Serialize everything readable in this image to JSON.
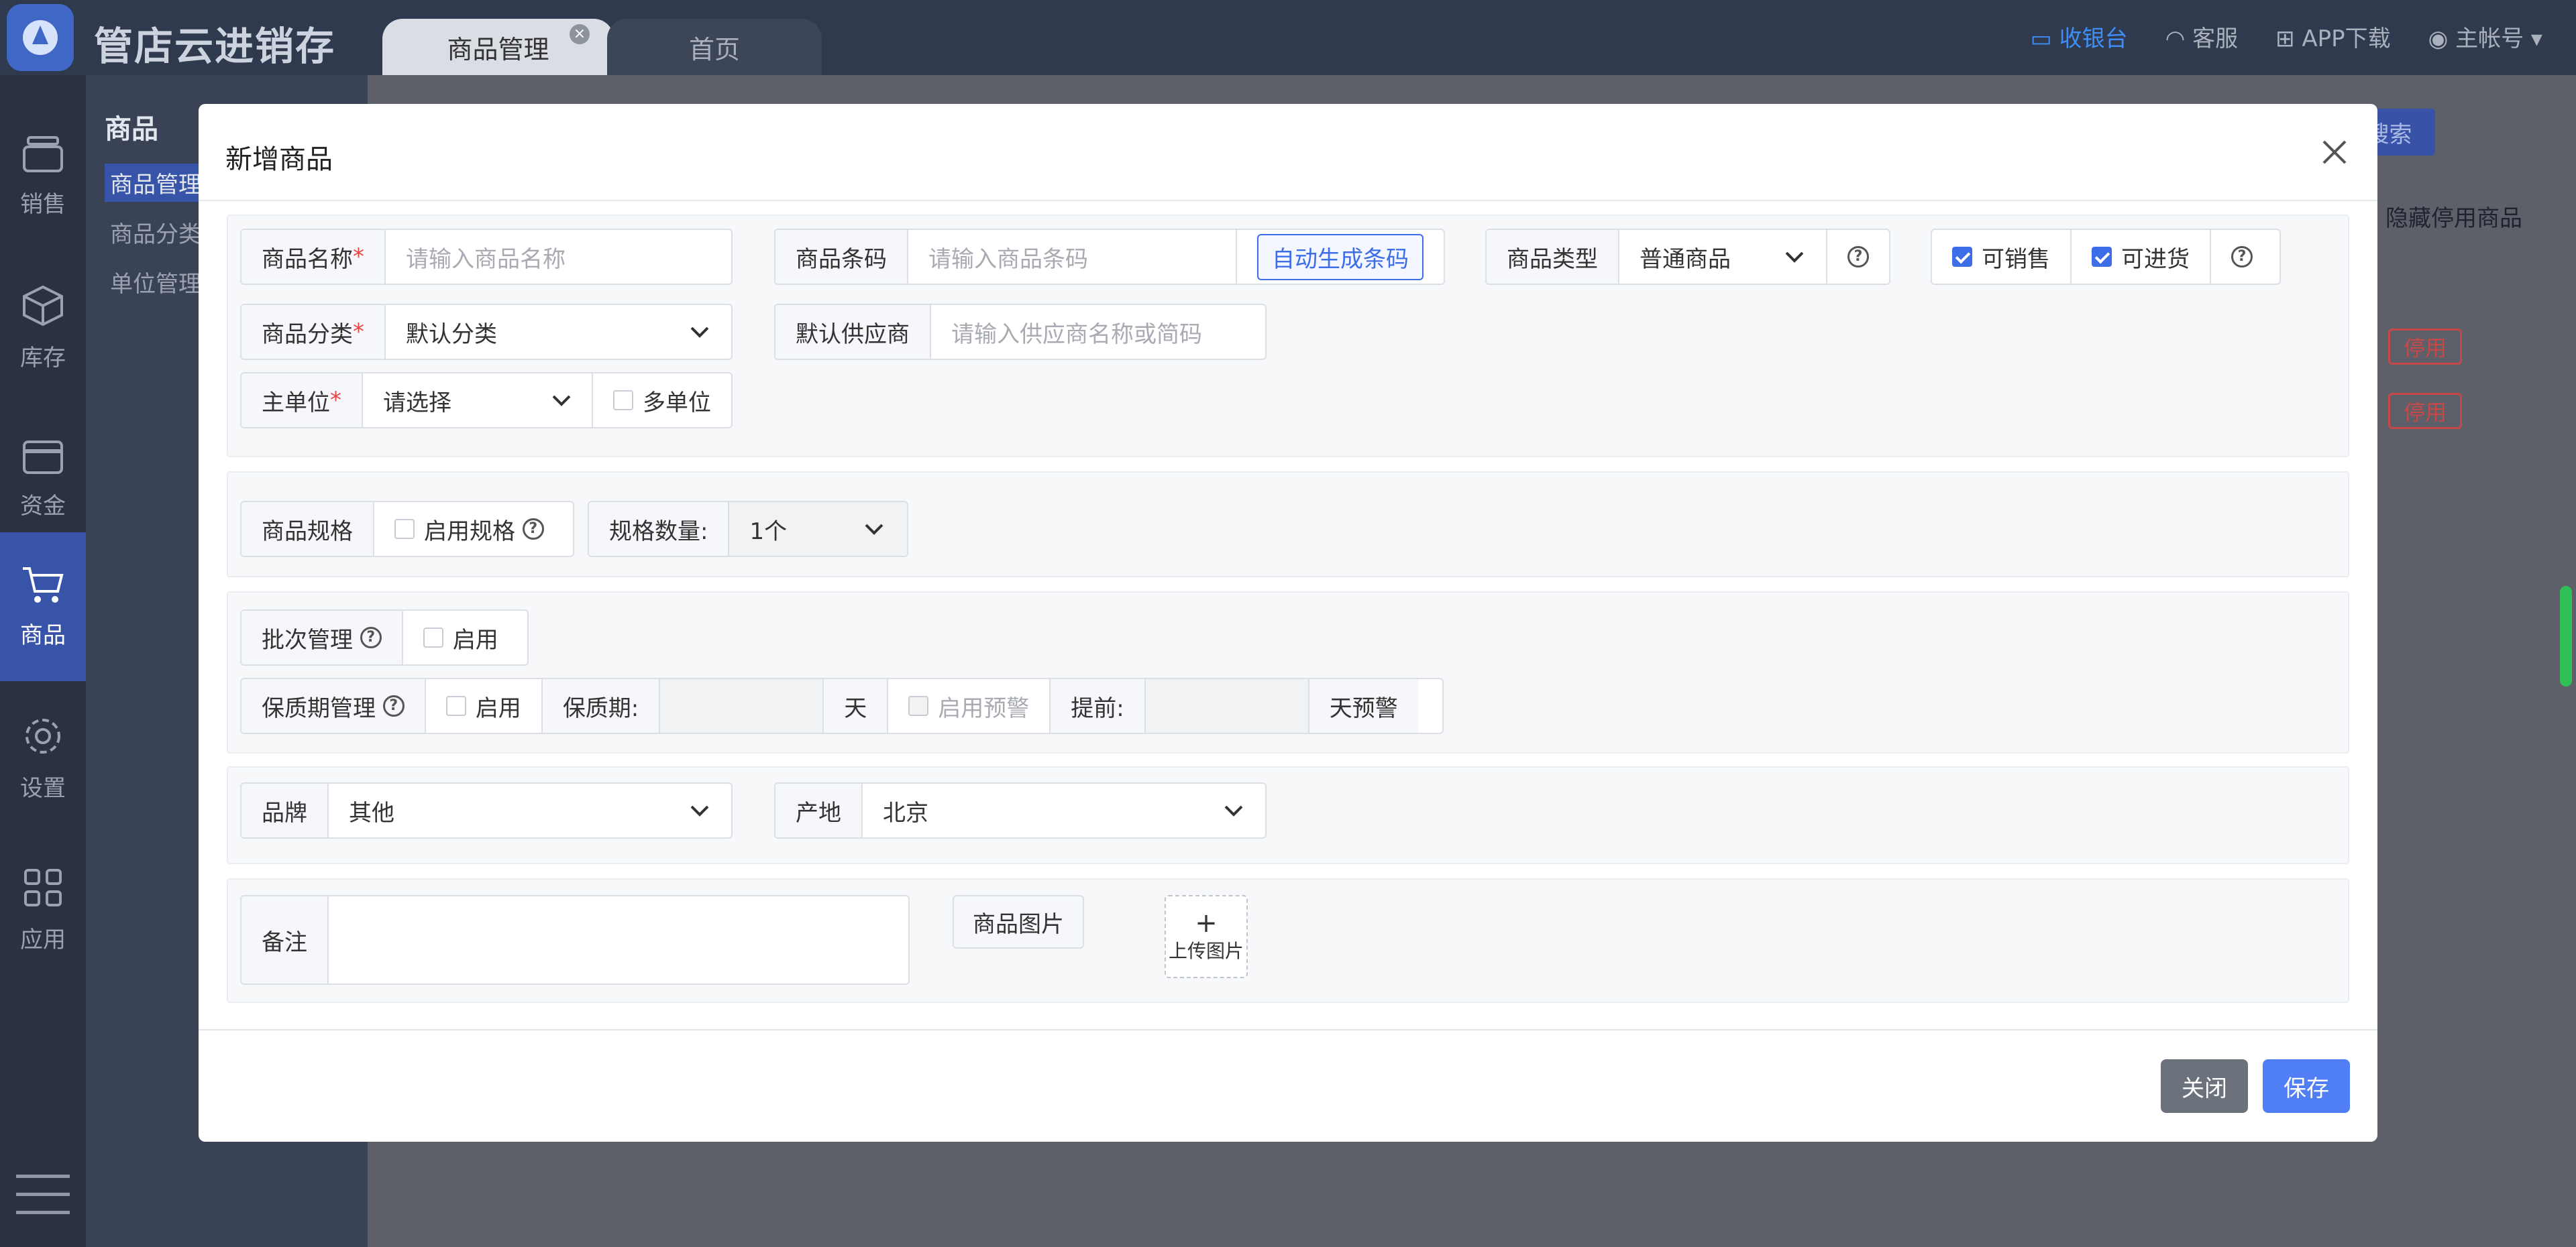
{
  "app": {
    "title": "管店云进销存"
  },
  "tabs": [
    {
      "label": "商品管理",
      "active": true
    },
    {
      "label": "首页",
      "active": false
    }
  ],
  "topbar": {
    "cashier": "收银台",
    "service": "客服",
    "app_download": "APP下载",
    "account": "主帐号"
  },
  "leftnav": [
    {
      "label": "销售",
      "icon": "register-icon"
    },
    {
      "label": "库存",
      "icon": "box-icon"
    },
    {
      "label": "资金",
      "icon": "card-icon"
    },
    {
      "label": "商品",
      "icon": "cart-icon",
      "active": true
    },
    {
      "label": "设置",
      "icon": "gear-icon"
    },
    {
      "label": "应用",
      "icon": "grid-icon"
    }
  ],
  "subnav": {
    "title": "商品",
    "items": [
      "商品管理",
      "商品分类",
      "单位管理"
    ]
  },
  "background": {
    "search": "搜索",
    "hide_disabled": "隐藏停用商品",
    "status_badge": "停用"
  },
  "modal": {
    "title": "新增商品",
    "basic": {
      "name_label": "商品名称",
      "name_placeholder": "请输入商品名称",
      "barcode_label": "商品条码",
      "barcode_placeholder": "请输入商品条码",
      "auto_barcode": "自动生成条码",
      "type_label": "商品类型",
      "type_value": "普通商品",
      "sellable": "可销售",
      "purchasable": "可进货",
      "category_label": "商品分类",
      "category_value": "默认分类",
      "supplier_label": "默认供应商",
      "supplier_placeholder": "请输入供应商名称或简码",
      "unit_label": "主单位",
      "unit_placeholder": "请选择",
      "multi_unit": "多单位"
    },
    "spec": {
      "label": "商品规格",
      "enable": "启用规格",
      "count_label": "规格数量:",
      "count_value": "1个"
    },
    "batch": {
      "label": "批次管理",
      "enable": "启用",
      "shelf_label": "保质期管理",
      "shelf_enable": "启用",
      "shelf_period": "保质期:",
      "day": "天",
      "warn_enable": "启用预警",
      "advance": "提前:",
      "warn_suffix": "天预警"
    },
    "brand": {
      "label": "品牌",
      "value": "其他",
      "origin_label": "产地",
      "origin_value": "北京"
    },
    "memo": {
      "label": "备注",
      "image_label": "商品图片",
      "upload": "上传图片"
    },
    "footer": {
      "close": "关闭",
      "save": "保存"
    }
  }
}
